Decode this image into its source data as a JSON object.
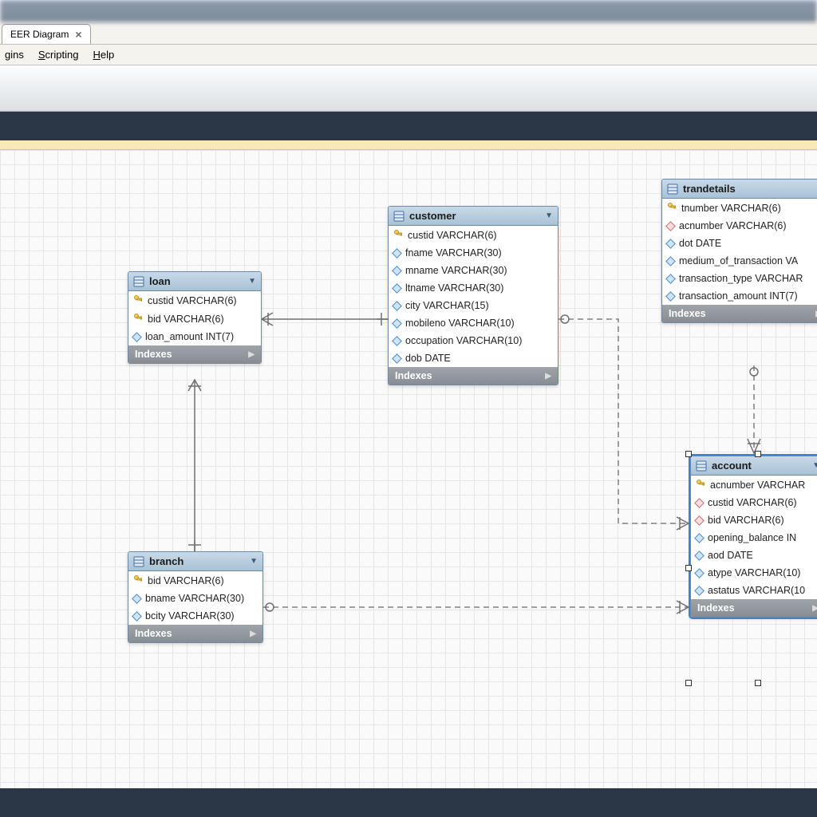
{
  "tab": {
    "label": "EER Diagram"
  },
  "menu": {
    "plugins": "gins",
    "plugins_mn": "",
    "scripting": "cripting",
    "scripting_mn": "S",
    "help": "elp",
    "help_mn": "H"
  },
  "indexes_label": "Indexes",
  "tables": {
    "loan": {
      "title": "loan",
      "cols": [
        {
          "icon": "key",
          "text": "custid VARCHAR(6)"
        },
        {
          "icon": "key",
          "text": "bid VARCHAR(6)"
        },
        {
          "icon": "diamond-blue",
          "text": "loan_amount INT(7)"
        }
      ]
    },
    "customer": {
      "title": "customer",
      "cols": [
        {
          "icon": "key",
          "text": "custid VARCHAR(6)"
        },
        {
          "icon": "diamond-blue",
          "text": "fname VARCHAR(30)"
        },
        {
          "icon": "diamond-blue",
          "text": "mname VARCHAR(30)"
        },
        {
          "icon": "diamond-blue",
          "text": "ltname VARCHAR(30)"
        },
        {
          "icon": "diamond-blue",
          "text": "city VARCHAR(15)"
        },
        {
          "icon": "diamond-blue",
          "text": "mobileno VARCHAR(10)"
        },
        {
          "icon": "diamond-blue",
          "text": "occupation VARCHAR(10)"
        },
        {
          "icon": "diamond-blue",
          "text": "dob DATE"
        }
      ]
    },
    "trandetails": {
      "title": "trandetails",
      "cols": [
        {
          "icon": "key",
          "text": "tnumber VARCHAR(6)"
        },
        {
          "icon": "diamond-red",
          "text": "acnumber VARCHAR(6)"
        },
        {
          "icon": "diamond-blue",
          "text": "dot DATE"
        },
        {
          "icon": "diamond-blue",
          "text": "medium_of_transaction VA"
        },
        {
          "icon": "diamond-blue",
          "text": "transaction_type VARCHAR"
        },
        {
          "icon": "diamond-blue",
          "text": "transaction_amount INT(7)"
        }
      ]
    },
    "branch": {
      "title": "branch",
      "cols": [
        {
          "icon": "key",
          "text": "bid VARCHAR(6)"
        },
        {
          "icon": "diamond-blue",
          "text": "bname VARCHAR(30)"
        },
        {
          "icon": "diamond-blue",
          "text": "bcity VARCHAR(30)"
        }
      ]
    },
    "account": {
      "title": "account",
      "cols": [
        {
          "icon": "key",
          "text": "acnumber VARCHAR"
        },
        {
          "icon": "diamond-red",
          "text": "custid VARCHAR(6)"
        },
        {
          "icon": "diamond-red",
          "text": "bid VARCHAR(6)"
        },
        {
          "icon": "diamond-blue",
          "text": "opening_balance IN"
        },
        {
          "icon": "diamond-blue",
          "text": "aod DATE"
        },
        {
          "icon": "diamond-blue",
          "text": "atype VARCHAR(10)"
        },
        {
          "icon": "diamond-blue",
          "text": "astatus VARCHAR(10"
        }
      ]
    }
  }
}
